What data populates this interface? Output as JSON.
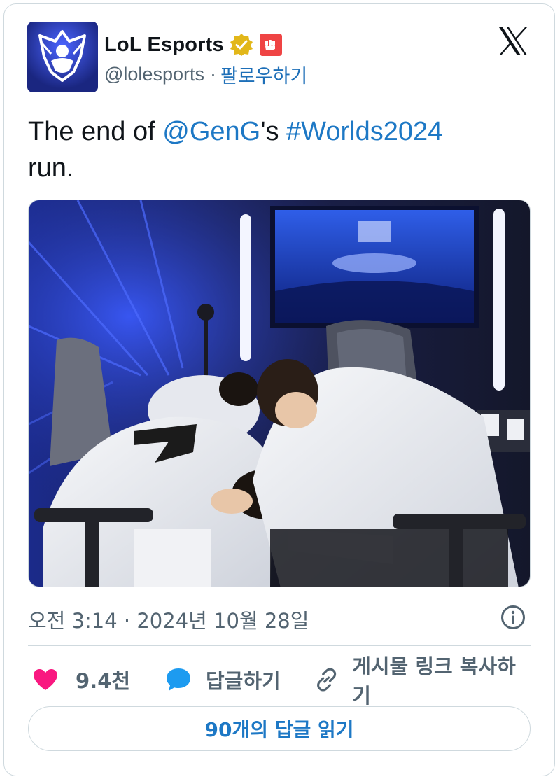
{
  "account": {
    "display_name": "LoL Esports",
    "handle": "@lolesports",
    "separator": "·",
    "follow_label": "팔로우하기",
    "verified_icon": "gold-verified-badge-icon",
    "affiliate_icon": "riot-games-fist-icon"
  },
  "tweet": {
    "text_before": "The end of ",
    "mention": "@GenG",
    "text_middle": "'s ",
    "hashtag": "#Worlds2024",
    "text_after": " run.",
    "timestamp": "오전 3:14 · 2024년 10월 28일"
  },
  "actions": {
    "like_count": "9.4천",
    "reply_label": "답글하기",
    "copy_link_label": "게시물 링크 복사하기"
  },
  "read_replies_label": "90개의 답글 읽기",
  "colors": {
    "link": "#1d78c5",
    "like": "#f91880",
    "reply": "#1d9bf0",
    "muted": "#536471",
    "verified": "#e2b719",
    "brand_badge": "#ef4444"
  },
  "icons": {
    "platform": "x-logo-icon",
    "info": "info-icon",
    "like": "heart-icon",
    "reply": "speech-bubble-icon",
    "copy_link": "link-icon"
  }
}
